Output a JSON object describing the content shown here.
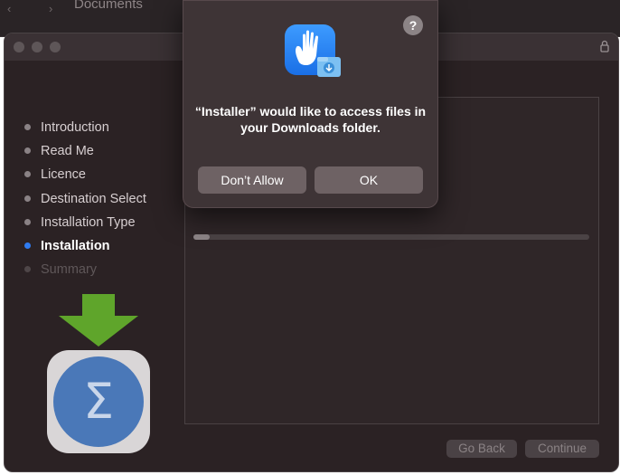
{
  "background_window": {
    "title": "Documents"
  },
  "installer": {
    "steps": [
      {
        "label": "Introduction",
        "state": "done"
      },
      {
        "label": "Read Me",
        "state": "done"
      },
      {
        "label": "Licence",
        "state": "done"
      },
      {
        "label": "Destination Select",
        "state": "done"
      },
      {
        "label": "Installation Type",
        "state": "done"
      },
      {
        "label": "Installation",
        "state": "active"
      },
      {
        "label": "Summary",
        "state": "pending"
      }
    ],
    "progress_fraction": 0.04,
    "buttons": {
      "go_back": "Go Back",
      "continue": "Continue"
    },
    "icons": {
      "lock": "lock-icon",
      "app": "sigma-app-icon",
      "download_arrow": "down-arrow-icon"
    }
  },
  "dialog": {
    "help_label": "?",
    "message": "“Installer” would like to access files in your Downloads folder.",
    "dont_allow_label": "Don’t Allow",
    "ok_label": "OK",
    "icon": "privacy-hand-icon"
  },
  "colors": {
    "accent": "#2f7bf0",
    "arrow_green": "#5fa52b",
    "sigma_blue": "#4a78b8"
  }
}
